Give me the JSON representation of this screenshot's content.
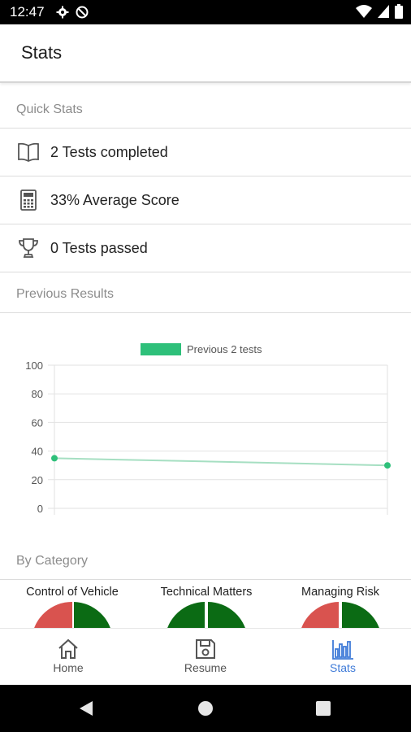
{
  "status_bar": {
    "time": "12:47"
  },
  "app_bar": {
    "title": "Stats"
  },
  "quick_stats": {
    "header": "Quick Stats",
    "items": [
      {
        "icon": "book-icon",
        "label": "2 Tests completed"
      },
      {
        "icon": "calculator-icon",
        "label": "33% Average Score"
      },
      {
        "icon": "trophy-icon",
        "label": "0 Tests passed"
      }
    ]
  },
  "previous_results": {
    "header": "Previous Results"
  },
  "chart_data": {
    "type": "line",
    "x": [
      1,
      2
    ],
    "series": [
      {
        "name": "Previous 2 tests",
        "values": [
          35,
          30
        ],
        "color": "#2ec07a"
      }
    ],
    "ylim": [
      0,
      100
    ],
    "yticks": [
      "0",
      "20",
      "40",
      "60",
      "80",
      "100"
    ],
    "grid": true,
    "legend": "top-center"
  },
  "by_category": {
    "header": "By Category",
    "items": [
      {
        "label": "Control of Vehicle"
      },
      {
        "label": "Technical Matters"
      },
      {
        "label": "Managing Risk"
      }
    ],
    "colors": {
      "pass": "#0b6b14",
      "fail": "#d9534f"
    }
  },
  "bottom_nav": {
    "items": [
      {
        "label": "Home",
        "icon": "home-icon"
      },
      {
        "label": "Resume",
        "icon": "floppy-disk-icon"
      },
      {
        "label": "Stats",
        "icon": "bar-chart-icon",
        "active": true
      }
    ],
    "active_color": "#3f7bd8"
  }
}
